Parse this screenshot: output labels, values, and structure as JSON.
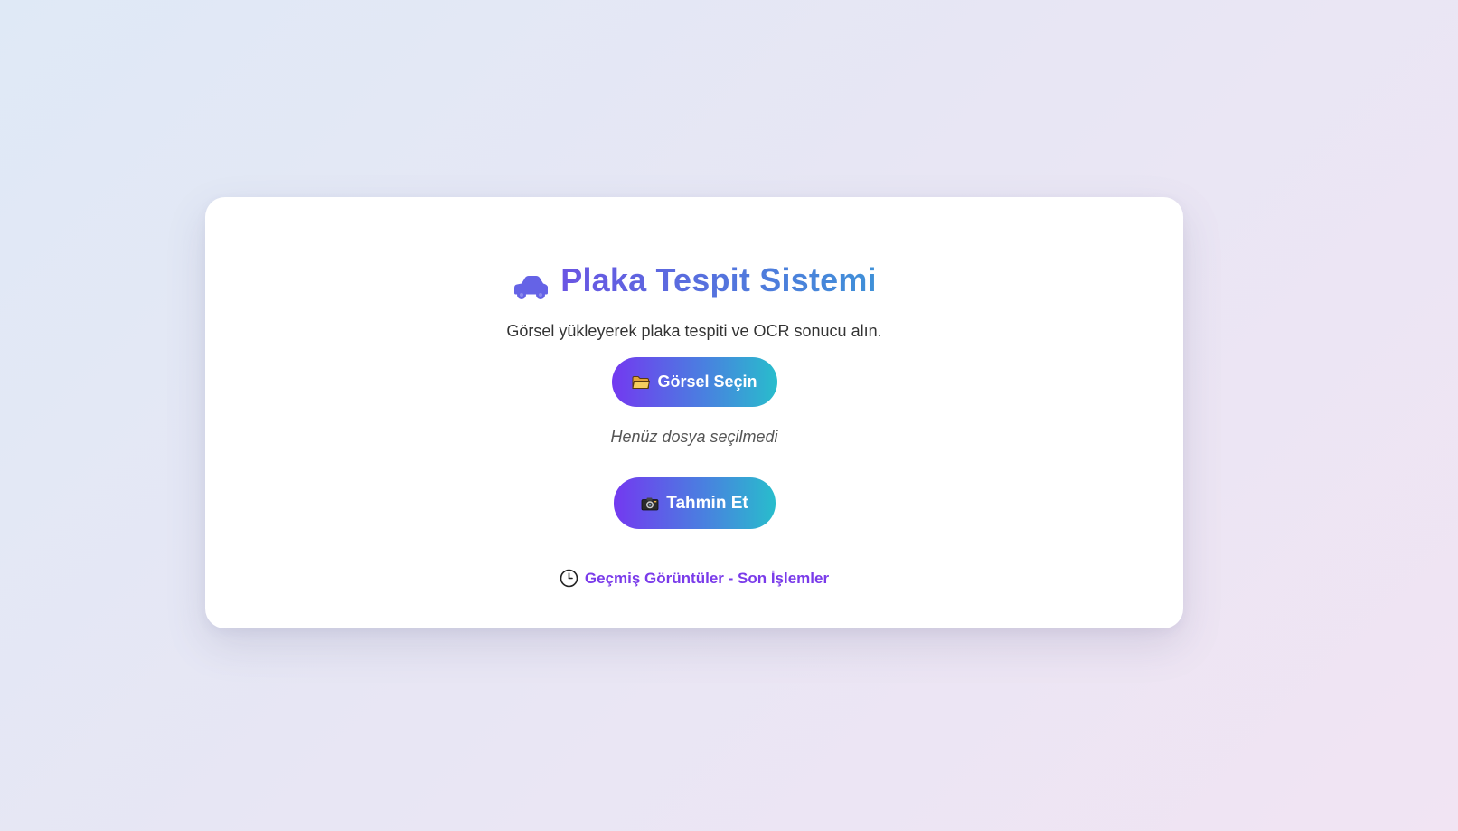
{
  "header": {
    "title": "Plaka Tespit Sistemi",
    "title_icon": "car-icon",
    "subtitle": "Görsel yükleyerek plaka tespiti ve OCR sonucu alın."
  },
  "upload": {
    "select_label": "Görsel Seçin",
    "select_icon": "folder-icon",
    "file_status": "Henüz dosya seçilmedi"
  },
  "predict": {
    "label": "Tahmin Et",
    "icon": "camera-icon"
  },
  "history": {
    "label": "Geçmiş Görüntüler - Son İşlemler",
    "icon": "clock-icon"
  },
  "colors": {
    "accent_start": "#7339f0",
    "accent_end": "#28bdcc",
    "title_start": "#6a55e3",
    "title_end": "#3f91d8",
    "link": "#7a3bea",
    "car": "#6563e6"
  }
}
